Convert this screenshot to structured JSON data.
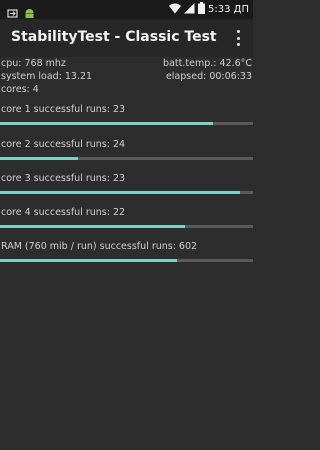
{
  "status_bar": {
    "time": "5:33 ДП",
    "icons": [
      "sync-icon",
      "android-icon",
      "wifi-icon",
      "signal-icon",
      "battery-icon"
    ]
  },
  "app_bar": {
    "title": "StabilityTest - Classic Test",
    "menu_icon": "overflow-menu-icon"
  },
  "info": {
    "cpu": "cpu: 768 mhz",
    "batt_temp": "batt.temp.: 42.6°C",
    "system_load": "system load: 13.21",
    "elapsed": "elapsed: 00:06:33",
    "cores": "cores: 4"
  },
  "tests": [
    {
      "label": "core 1 successful runs: 23",
      "progress": 0.84
    },
    {
      "label": "core 2 successful runs: 24",
      "progress": 0.31
    },
    {
      "label": "core 3 successful runs: 23",
      "progress": 0.95
    },
    {
      "label": "core 4 successful runs: 22",
      "progress": 0.73
    },
    {
      "label": "RAM (760 mib / run) successful runs: 602",
      "progress": 0.7
    }
  ],
  "colors": {
    "background": "#2d2d2d",
    "status_bar": "#1a1a1a",
    "app_bar": "#272727",
    "progress_fill": "#7ecfc4",
    "progress_track": "#5a5a5a"
  }
}
